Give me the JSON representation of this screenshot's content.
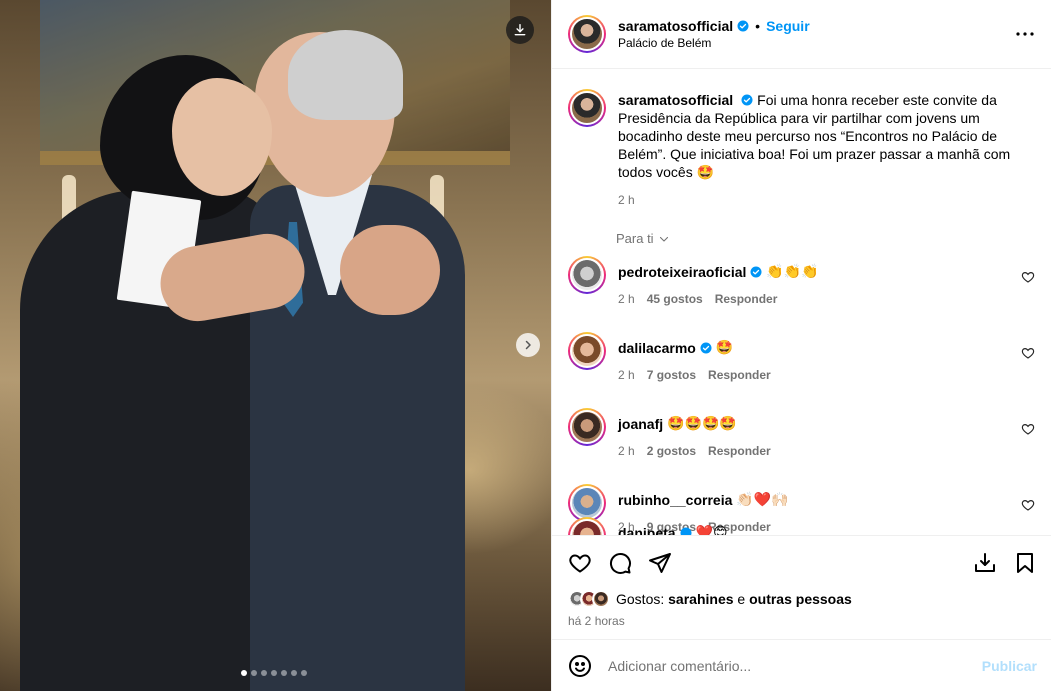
{
  "header": {
    "username": "saramatosofficial",
    "separator": "•",
    "follow_label": "Seguir",
    "location": "Palácio de Belém"
  },
  "caption": {
    "username": "saramatosofficial",
    "text": "Foi uma honra receber este convite da Presidência da República para vir partilhar com jovens um bocadinho deste meu percurso nos “Encontros no Palácio de Belém”. Que iniciativa boa! Foi um prazer passar a manhã com todos vocês 🤩",
    "time": "2 h"
  },
  "for_you_label": "Para ti",
  "comments": [
    {
      "username": "pedroteixeiraoficial",
      "verified": true,
      "text": "👏👏👏",
      "time": "2 h",
      "likes": "45 gostos",
      "reply": "Responder"
    },
    {
      "username": "dalilacarmo",
      "verified": true,
      "text": "🤩",
      "time": "2 h",
      "likes": "7 gostos",
      "reply": "Responder"
    },
    {
      "username": "joanafj",
      "verified": false,
      "text": "🤩🤩🤩🤩",
      "time": "2 h",
      "likes": "2 gostos",
      "reply": "Responder"
    },
    {
      "username": "rubinho__correia",
      "verified": false,
      "text": "👏🏻❤️🙌🏻",
      "time": "2 h",
      "likes": "9 gostos",
      "reply": "Responder"
    }
  ],
  "partial_comment": {
    "username": "danipeta",
    "text": "❤️😊"
  },
  "likes": {
    "prefix": "Gostos:",
    "user": "sarahines",
    "connector": "e",
    "others": "outras pessoas"
  },
  "post_time": "há 2 horas",
  "add_comment": {
    "placeholder": "Adicionar comentário...",
    "publish_label": "Publicar"
  },
  "carousel": {
    "total": 7,
    "current": 1
  },
  "colors": {
    "link_blue": "#0095f6",
    "publish_disabled": "#b2dffc",
    "secondary_text": "#737373",
    "verified_blue": "#0095f6"
  }
}
